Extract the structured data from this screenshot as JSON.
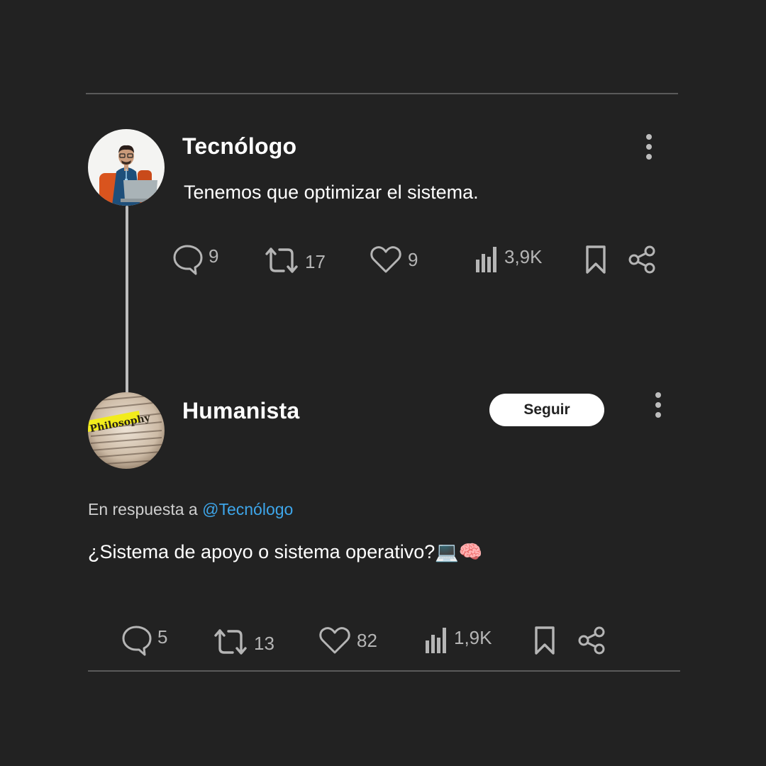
{
  "colors": {
    "background": "#222222",
    "text": "#ffffff",
    "muted": "#b5b5b5",
    "link": "#3ea6ea",
    "follow_button_bg": "#ffffff",
    "divider": "#5a5a5a"
  },
  "original_post": {
    "author_name": "Tecnólogo",
    "text": "Tenemos que optimizar el sistema.",
    "menu_icon": "more-vertical-icon",
    "stats": {
      "replies": "9",
      "reposts": "17",
      "likes": "9",
      "views": "3,9K"
    }
  },
  "reply_post": {
    "author_name": "Humanista",
    "follow_label": "Seguir",
    "menu_icon": "more-vertical-icon",
    "avatar_text": "Philosophy",
    "reply_prefix": "En respuesta a ",
    "reply_handle": "@Tecnólogo",
    "text": "¿Sistema de apoyo o sistema operativo?💻🧠",
    "stats": {
      "replies": "5",
      "reposts": "13",
      "likes": "82",
      "views": "1,9K"
    }
  },
  "icons": [
    "reply-icon",
    "repost-icon",
    "like-icon",
    "views-icon",
    "bookmark-icon",
    "share-icon"
  ]
}
